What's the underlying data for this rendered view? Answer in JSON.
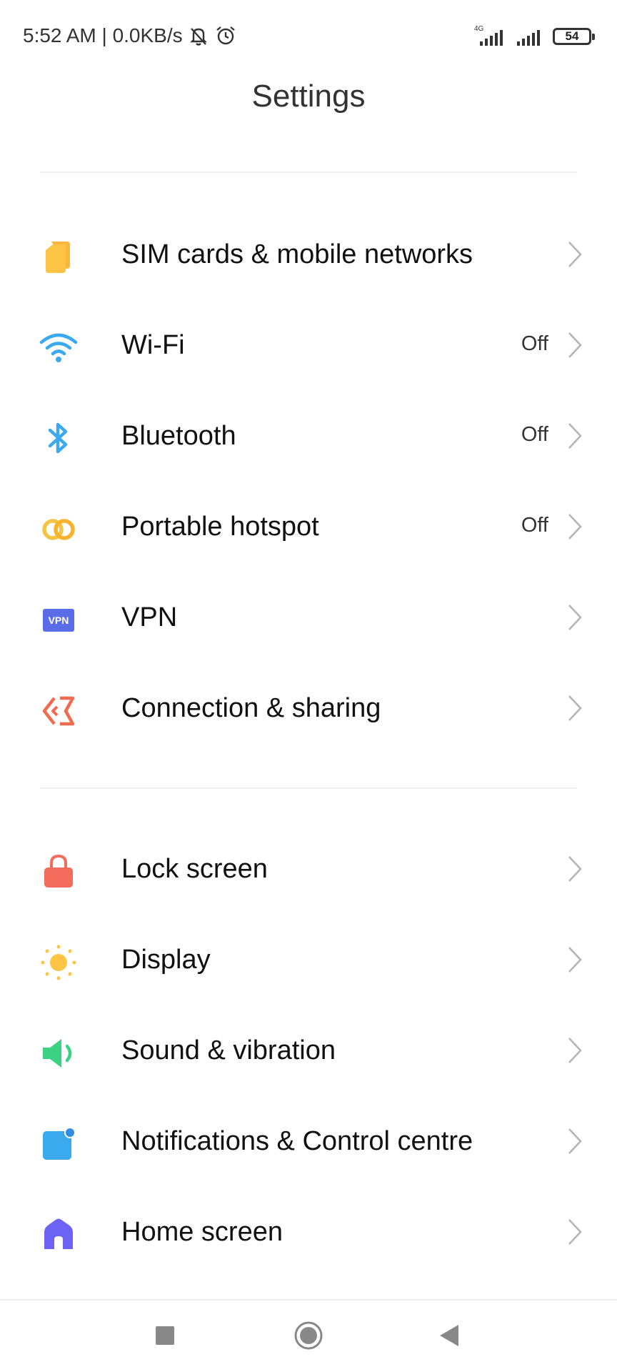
{
  "status_bar": {
    "time_speed": "5:52 AM | 0.0KB/s",
    "network_type": "4G",
    "battery": "54"
  },
  "header": {
    "title": "Settings"
  },
  "groups": [
    {
      "items": [
        {
          "label": "SIM cards & mobile networks",
          "status": "",
          "icon": "sim-card-icon",
          "color": "#FDC445"
        },
        {
          "label": "Wi-Fi",
          "status": "Off",
          "icon": "wifi-icon",
          "color": "#3BA9EE"
        },
        {
          "label": "Bluetooth",
          "status": "Off",
          "icon": "bluetooth-icon",
          "color": "#3BA9EE"
        },
        {
          "label": "Portable hotspot",
          "status": "Off",
          "icon": "hotspot-icon",
          "color": "#F4C544"
        },
        {
          "label": "VPN",
          "status": "",
          "icon": "vpn-icon",
          "icon_text": "VPN",
          "color": "#5B6CE8"
        },
        {
          "label": "Connection & sharing",
          "status": "",
          "icon": "connection-sharing-icon",
          "color": "#F26B50"
        }
      ]
    },
    {
      "items": [
        {
          "label": "Lock screen",
          "status": "",
          "icon": "lock-icon",
          "color": "#F26B5B"
        },
        {
          "label": "Display",
          "status": "",
          "icon": "sun-icon",
          "color": "#FDC445"
        },
        {
          "label": "Sound & vibration",
          "status": "",
          "icon": "speaker-icon",
          "color": "#3DD283"
        },
        {
          "label": "Notifications & Control centre",
          "status": "",
          "icon": "notification-icon",
          "color": "#3BA9EE"
        },
        {
          "label": "Home screen",
          "status": "",
          "icon": "home-icon",
          "color": "#6C63F5"
        }
      ]
    }
  ],
  "nav_bar": {
    "recents": "recents-icon",
    "home": "home-nav-icon",
    "back": "back-icon"
  }
}
